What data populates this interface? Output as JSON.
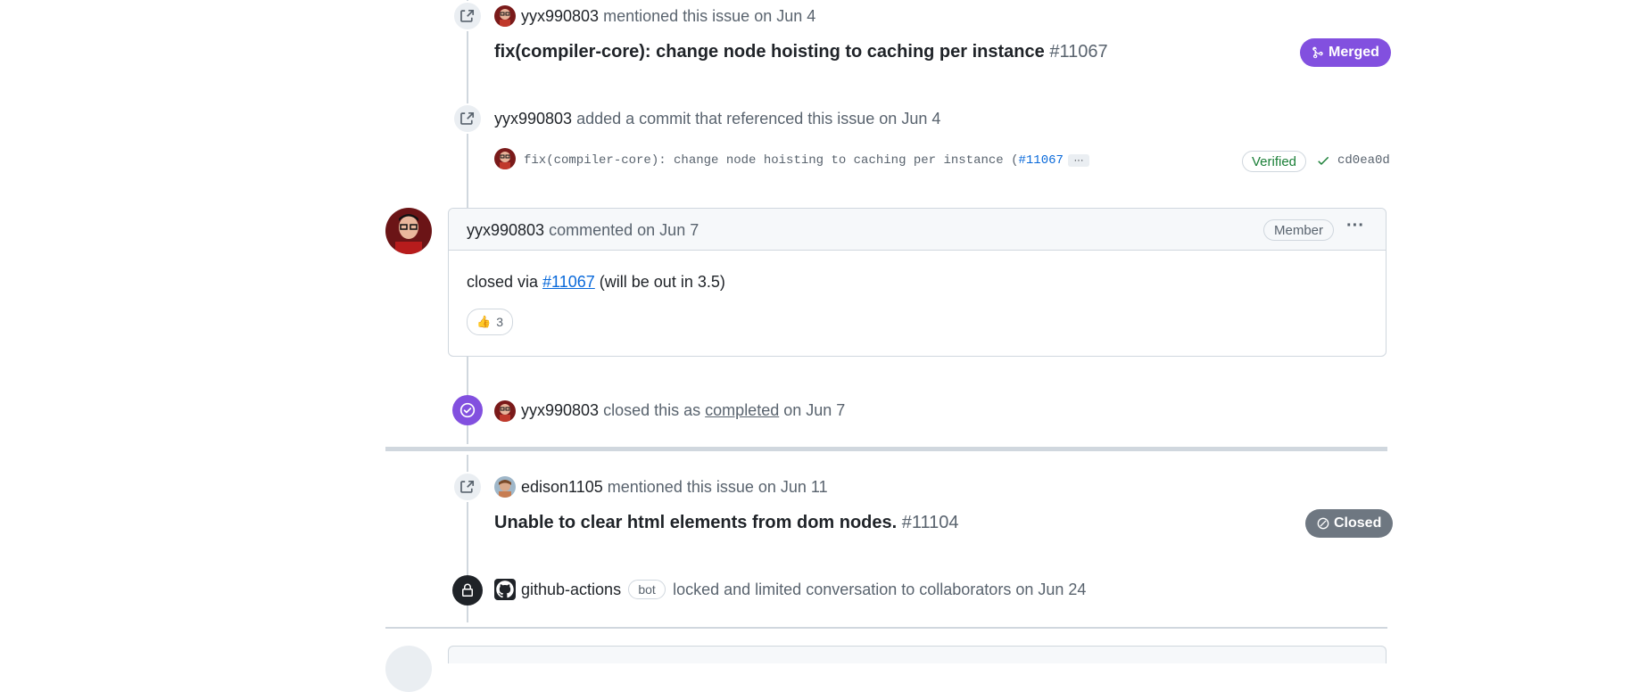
{
  "events": {
    "mention1": {
      "author": "yyx990803",
      "action": "mentioned this issue",
      "date": "on Jun 4",
      "title": "fix(compiler-core): change node hoisting to caching per instance",
      "number": "#11067",
      "state": "Merged",
      "state_color": "#8250df"
    },
    "commit": {
      "author": "yyx990803",
      "action": "added a commit that referenced this issue",
      "date": "on Jun 4",
      "message": "fix(compiler-core): change node hoisting to caching per instance (",
      "message_link": "#11067",
      "ellipsis": "···",
      "verified": "Verified",
      "sha": "cd0ea0d"
    },
    "comment": {
      "author": "yyx990803",
      "action": "commented",
      "date": "on Jun 7",
      "role": "Member",
      "menu": "···",
      "body_prefix": "closed via ",
      "body_link": "#11067",
      "body_suffix": " (will be out in 3.5)",
      "reaction_emoji": "👍",
      "reaction_count": "3"
    },
    "closed": {
      "author": "yyx990803",
      "action": "closed this as",
      "reason": "completed",
      "date": "on Jun 7"
    },
    "mention2": {
      "author": "edison1105",
      "action": "mentioned this issue",
      "date": "on Jun 11",
      "title": "Unable to clear html elements from dom nodes.",
      "number": "#11104",
      "state": "Closed",
      "state_color": "#6e7781"
    },
    "locked": {
      "author": "github-actions",
      "bot_label": "bot",
      "action": "locked and limited conversation to collaborators",
      "date": "on Jun 24"
    }
  },
  "icons": {
    "cross_reference": "cross-reference-icon",
    "merged": "git-merge-icon",
    "check": "check-icon",
    "completed": "check-circle-icon",
    "closed": "skip-icon",
    "lock": "lock-icon",
    "github_logo": "github-logo-icon"
  },
  "colors": {
    "link": "#0969da",
    "purple": "#8250df",
    "verified": "#1a7f37",
    "gray_pill": "#6e7781"
  }
}
